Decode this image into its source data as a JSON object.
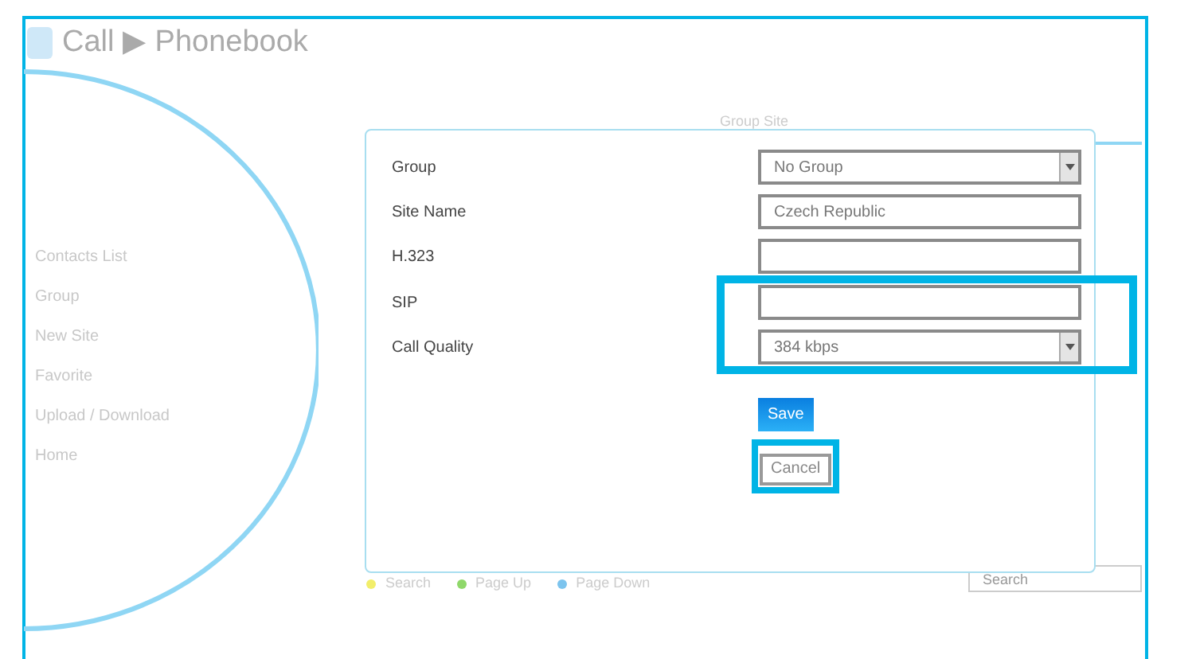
{
  "header": {
    "title": "Call ▶ Phonebook"
  },
  "sidebar": {
    "items": [
      {
        "label": "Contacts List"
      },
      {
        "label": "Group"
      },
      {
        "label": "New Site"
      },
      {
        "label": "Favorite"
      },
      {
        "label": "Upload / Download"
      },
      {
        "label": "Home"
      }
    ]
  },
  "background": {
    "tab_label": "Group Site",
    "legend": [
      {
        "label": "Search",
        "color": "#f2ee6a"
      },
      {
        "label": "Page Up",
        "color": "#8fd86a"
      },
      {
        "label": "Page Down",
        "color": "#7cc4ee"
      }
    ],
    "search": {
      "placeholder": "Search"
    }
  },
  "dialog": {
    "rows": [
      {
        "label": "Group",
        "kind": "select",
        "value": "No Group",
        "highlighted": false
      },
      {
        "label": "Site Name",
        "kind": "text",
        "value": "Czech Republic",
        "highlighted": false
      },
      {
        "label": "H.323",
        "kind": "text",
        "highlighted": false
      },
      {
        "label": "SIP",
        "kind": "text",
        "highlighted": true
      },
      {
        "label": "Call Quality",
        "kind": "select",
        "value": "384 kbps",
        "highlighted": true
      }
    ],
    "buttons": [
      {
        "label": "Save",
        "kind": "primary",
        "highlighted": false
      },
      {
        "label": "Cancel",
        "kind": "secondary",
        "highlighted": true
      }
    ]
  }
}
